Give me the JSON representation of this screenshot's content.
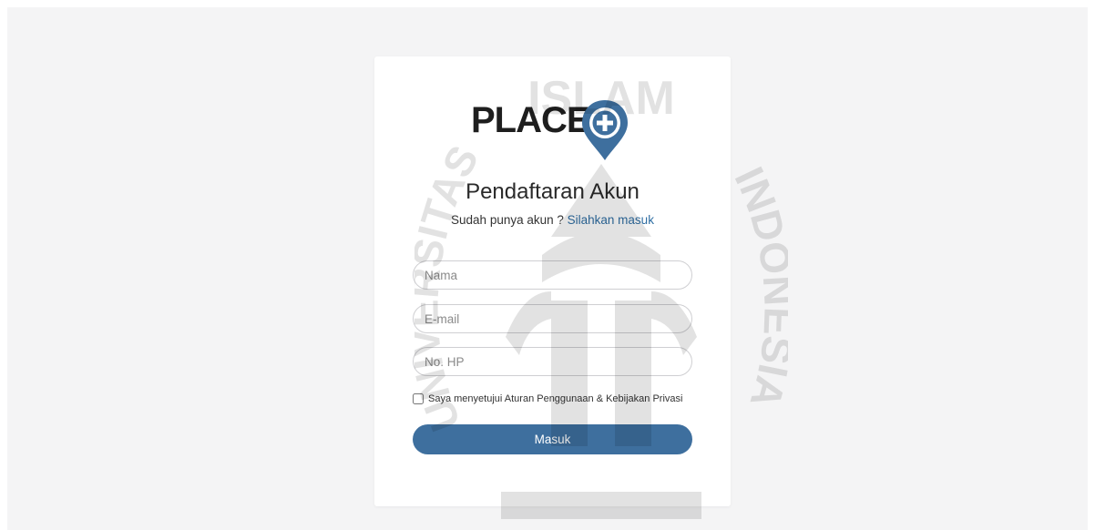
{
  "brand": {
    "logo_text": "PLACE",
    "logo_icon": "plus-pin-icon",
    "accent_color": "#3e6f9e",
    "link_color": "#2f6ea3"
  },
  "form": {
    "title": "Pendaftaran Akun",
    "subtitle_text": "Sudah punya akun ? ",
    "login_link": "Silahkan masuk",
    "name_placeholder": "Nama",
    "email_placeholder": "E-mail",
    "phone_placeholder": "No. HP",
    "agree_label": "Saya menyetujui Aturan Penggunaan & Kebijakan Privasi",
    "agree_checked": false,
    "submit_label": "Masuk"
  },
  "watermark": {
    "top_text": "ISLAM",
    "left_text": "UNIVERSITAS",
    "right_text": "INDONESIA"
  }
}
